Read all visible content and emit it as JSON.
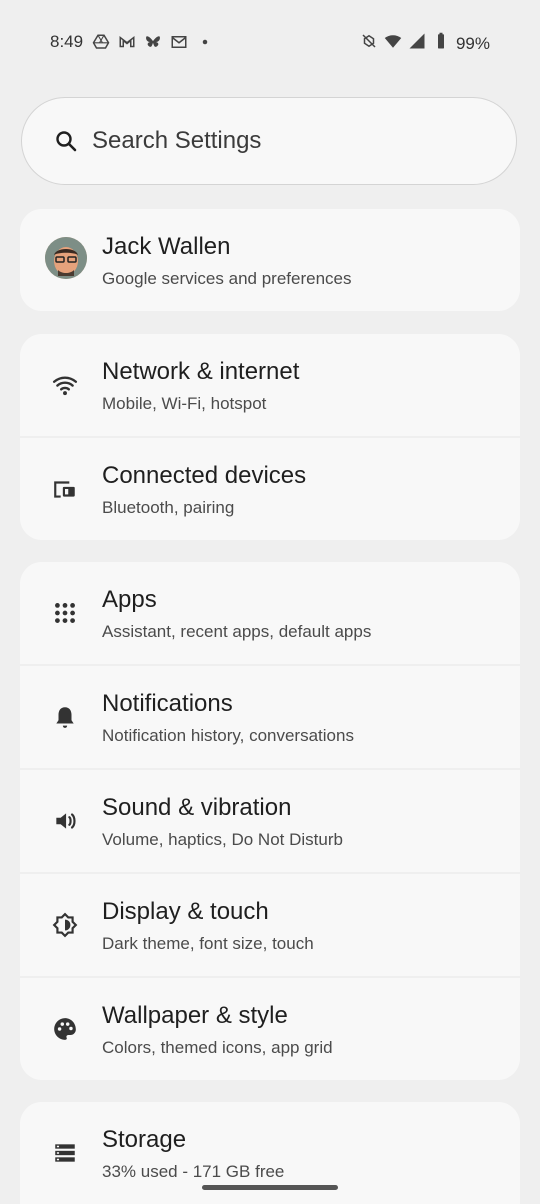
{
  "status_bar": {
    "time": "8:49",
    "battery": "99%",
    "left_icons": [
      "drive-icon",
      "gmail-icon",
      "bluesky-icon",
      "mail-icon",
      "dot-icon"
    ],
    "right_icons": [
      "silent-icon",
      "wifi-icon",
      "signal-icon",
      "battery-icon"
    ]
  },
  "search": {
    "label": "Search Settings"
  },
  "account": {
    "name": "Jack Wallen",
    "subtitle": "Google services and preferences"
  },
  "groups": [
    {
      "items": [
        {
          "title": "Network & internet",
          "subtitle": "Mobile, Wi-Fi, hotspot",
          "icon": "wifi-icon"
        },
        {
          "title": "Connected devices",
          "subtitle": "Bluetooth, pairing",
          "icon": "devices-icon"
        }
      ]
    },
    {
      "items": [
        {
          "title": "Apps",
          "subtitle": "Assistant, recent apps, default apps",
          "icon": "apps-grid-icon"
        },
        {
          "title": "Notifications",
          "subtitle": "Notification history, conversations",
          "icon": "bell-icon"
        },
        {
          "title": "Sound & vibration",
          "subtitle": "Volume, haptics, Do Not Disturb",
          "icon": "speaker-icon"
        },
        {
          "title": "Display & touch",
          "subtitle": "Dark theme, font size, touch",
          "icon": "brightness-icon"
        },
        {
          "title": "Wallpaper & style",
          "subtitle": "Colors, themed icons, app grid",
          "icon": "palette-icon"
        }
      ]
    },
    {
      "items": [
        {
          "title": "Storage",
          "subtitle": "33% used - 171 GB free",
          "icon": "storage-icon"
        }
      ]
    }
  ]
}
